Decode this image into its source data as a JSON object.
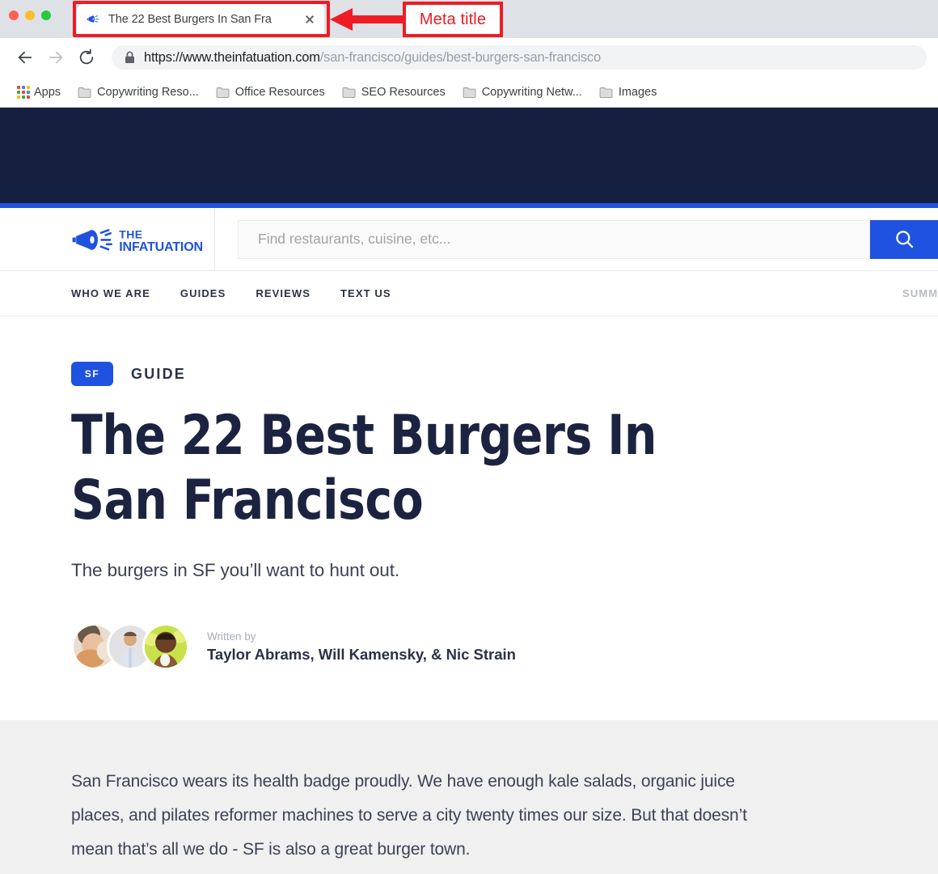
{
  "browser": {
    "tab": {
      "title": "The 22 Best Burgers In San Fra",
      "favicon": "megaphone-icon",
      "close_label": "close-tab"
    },
    "traffic_lights": [
      "close-red",
      "minimize-yellow",
      "maximize-green"
    ],
    "toolbar": {
      "back": "back-arrow-icon",
      "forward": "forward-arrow-icon",
      "reload": "reload-icon",
      "lock": "lock-icon",
      "url_scheme": "https://www.theinfatuation.com",
      "url_path": "/san-francisco/guides/best-burgers-san-francisco"
    },
    "bookmarks": [
      {
        "label": "Apps",
        "icon": "apps-grid-icon"
      },
      {
        "label": "Copywriting Reso...",
        "icon": "folder-icon"
      },
      {
        "label": "Office Resources",
        "icon": "folder-icon"
      },
      {
        "label": "SEO Resources",
        "icon": "folder-icon"
      },
      {
        "label": "Copywriting Netw...",
        "icon": "folder-icon"
      },
      {
        "label": "Images",
        "icon": "folder-icon"
      }
    ]
  },
  "annotation": {
    "label": "Meta title",
    "color": "#ee1c24",
    "arrow": "left-arrow-icon"
  },
  "site": {
    "logo": {
      "name": "the-infatuation-logo",
      "line1": "THE",
      "line2": "INFATUATION"
    },
    "search": {
      "placeholder": "Find restaurants, cuisine, etc...",
      "value": "",
      "button_icon": "search-icon"
    },
    "nav": {
      "links": [
        {
          "label": "WHO WE ARE"
        },
        {
          "label": "GUIDES"
        },
        {
          "label": "REVIEWS"
        },
        {
          "label": "TEXT US"
        }
      ],
      "right_label": "SUMM"
    },
    "colors": {
      "brand_blue": "#1f52e0",
      "banner_navy": "#152040",
      "heading_navy": "#1b2340",
      "lede_bg": "#f0f0f0"
    }
  },
  "article": {
    "badge": "SF",
    "kicker": "GUIDE",
    "headline": "The 22 Best Burgers In San Francisco",
    "dek": "The burgers in SF you’ll want to hunt out.",
    "byline": {
      "written_by": "Written by",
      "authors": "Taylor Abrams, Will Kamensky, & Nic Strain",
      "avatars": [
        "author-avatar-1",
        "author-avatar-2",
        "author-avatar-3"
      ]
    },
    "lede": "San Francisco wears its health badge proudly. We have enough kale salads, organic juice places, and pilates reformer machines to serve a city twenty times our size. But that doesn’t mean that’s all we do - SF is also a great burger town."
  }
}
